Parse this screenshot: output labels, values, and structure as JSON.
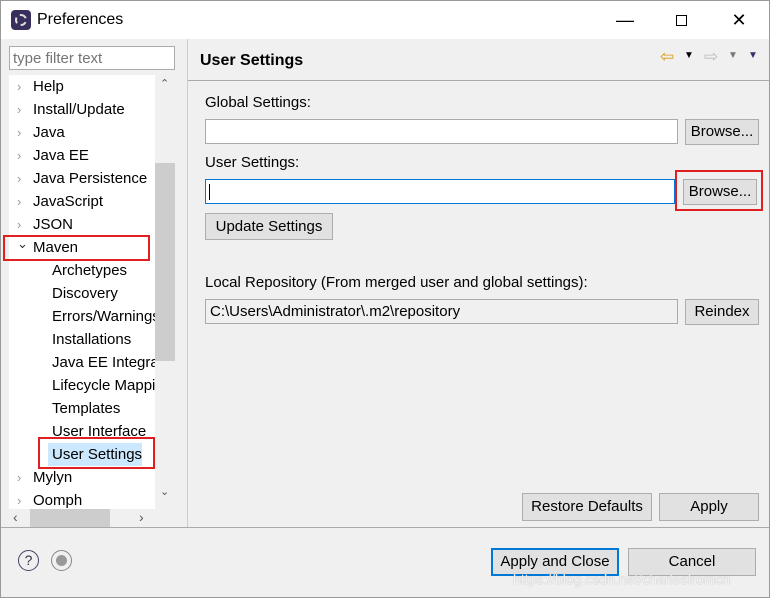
{
  "window": {
    "title": "Preferences",
    "minimize_icon": "minimize-icon",
    "maximize_icon": "maximize-icon",
    "close_icon": "close-icon"
  },
  "sidebar": {
    "filter_placeholder": "type filter text",
    "items": [
      {
        "label": "Help",
        "expanded": false
      },
      {
        "label": "Install/Update",
        "expanded": false
      },
      {
        "label": "Java",
        "expanded": false
      },
      {
        "label": "Java EE",
        "expanded": false
      },
      {
        "label": "Java Persistence",
        "expanded": false
      },
      {
        "label": "JavaScript",
        "expanded": false
      },
      {
        "label": "JSON",
        "expanded": false
      },
      {
        "label": "Maven",
        "expanded": true,
        "children": [
          "Archetypes",
          "Discovery",
          "Errors/Warnings",
          "Installations",
          "Java EE Integration",
          "Lifecycle Mappings",
          "Templates",
          "User Interface",
          "User Settings"
        ]
      },
      {
        "label": "Mylyn",
        "expanded": false
      },
      {
        "label": "Oomph",
        "expanded": false
      }
    ],
    "selected": "User Settings"
  },
  "main": {
    "title": "User Settings",
    "global_settings_label": "Global Settings:",
    "global_settings_value": "",
    "user_settings_label": "User Settings:",
    "user_settings_value": "",
    "browse_label": "Browse...",
    "update_settings_label": "Update Settings",
    "local_repo_label": "Local Repository (From merged user and global settings):",
    "local_repo_value": "C:\\Users\\Administrator\\.m2\\repository",
    "reindex_label": "Reindex",
    "restore_defaults_label": "Restore Defaults",
    "apply_label": "Apply"
  },
  "footer": {
    "apply_close_label": "Apply and Close",
    "cancel_label": "Cancel"
  },
  "watermark": "https://blog.csdn.net/charlesfromcn",
  "colors": {
    "highlight": "#e02020",
    "default_button_border": "#0078d7",
    "selection": "#cce8ff"
  }
}
